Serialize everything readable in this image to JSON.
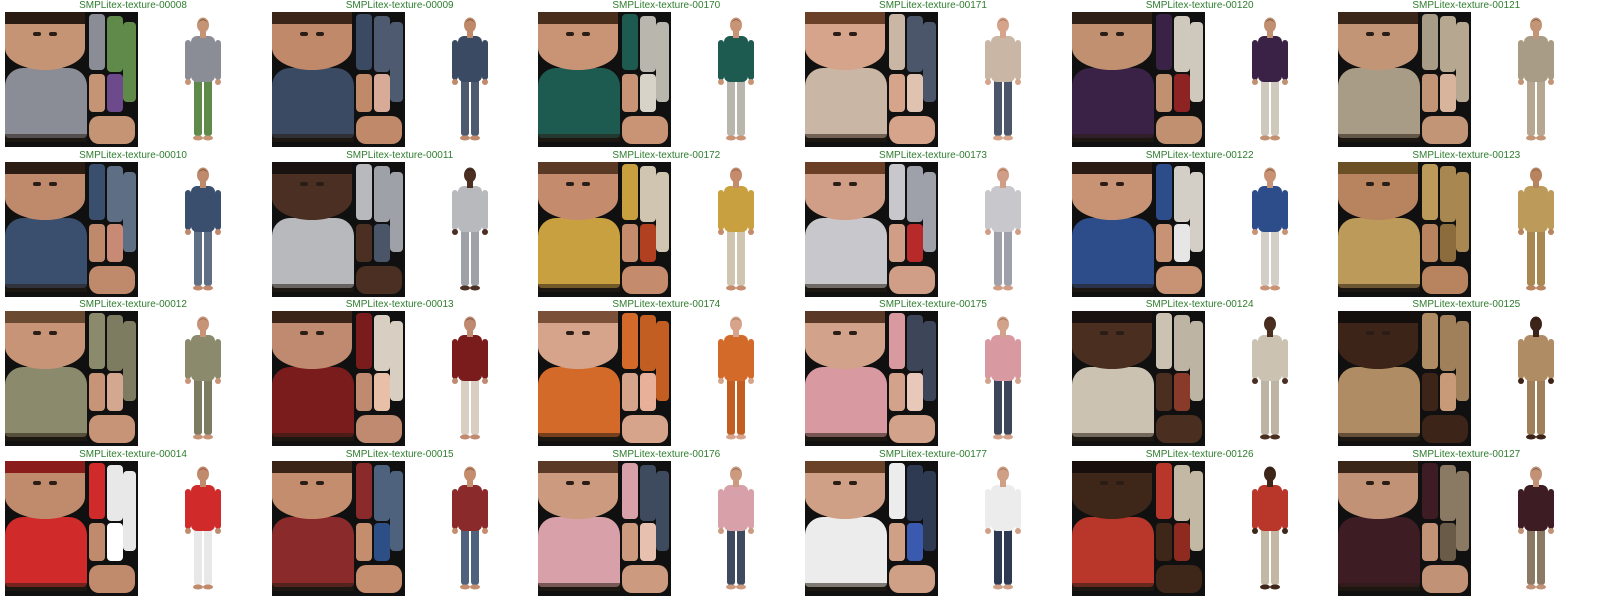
{
  "tiles": [
    {
      "label": "SMPLitex-texture-00008",
      "skin": "#c59475",
      "hair": "#2a1b12",
      "shirt": "#8a8c96",
      "pants": "#5f8a4a",
      "accent": "#6d4a8c"
    },
    {
      "label": "SMPLitex-texture-00009",
      "skin": "#c08a6a",
      "hair": "#3a2518",
      "shirt": "#3b4a63",
      "pants": "#4d5a70",
      "accent": "#d8aa98"
    },
    {
      "label": "SMPLitex-texture-00170",
      "skin": "#c99476",
      "hair": "#4a2e1c",
      "shirt": "#1d5a4f",
      "pants": "#b9b6ad",
      "accent": "#d7d3c8"
    },
    {
      "label": "SMPLitex-texture-00171",
      "skin": "#d5a48a",
      "hair": "#6a4028",
      "shirt": "#c9b6a4",
      "pants": "#4b566b",
      "accent": "#e0c2b0"
    },
    {
      "label": "SMPLitex-texture-00120",
      "skin": "#c09070",
      "hair": "#2d1e16",
      "shirt": "#3a2246",
      "pants": "#cfc8bd",
      "accent": "#8e2323"
    },
    {
      "label": "SMPLitex-texture-00121",
      "skin": "#c29577",
      "hair": "#3a271a",
      "shirt": "#a99c86",
      "pants": "#b6a890",
      "accent": "#d9b49c"
    },
    {
      "label": "SMPLitex-texture-00010",
      "skin": "#bf8a6c",
      "hair": "#2b1c14",
      "shirt": "#3a4e6e",
      "pants": "#5e6e85",
      "accent": "#c88a74"
    },
    {
      "label": "SMPLitex-texture-00011",
      "skin": "#4a2f22",
      "hair": "#1a1210",
      "shirt": "#b7b9bd",
      "pants": "#9ea1a8",
      "accent": "#4a5668"
    },
    {
      "label": "SMPLitex-texture-00172",
      "skin": "#c48c6c",
      "hair": "#5a3a24",
      "shirt": "#c8a040",
      "pants": "#d0c5b0",
      "accent": "#b04020"
    },
    {
      "label": "SMPLitex-texture-00173",
      "skin": "#d09e86",
      "hair": "#6b3f26",
      "shirt": "#c8c8cc",
      "pants": "#9ea0aa",
      "accent": "#b82a2a"
    },
    {
      "label": "SMPLitex-texture-00122",
      "skin": "#c89274",
      "hair": "#2a1c14",
      "shirt": "#2d4c8a",
      "pants": "#d4cfc6",
      "accent": "#e6e6e6"
    },
    {
      "label": "SMPLitex-texture-00123",
      "skin": "#b88460",
      "hair": "#6a5024",
      "shirt": "#bc9a5a",
      "pants": "#a88850",
      "accent": "#8c6c3c"
    },
    {
      "label": "SMPLitex-texture-00012",
      "skin": "#c89478",
      "hair": "#6a4a30",
      "shirt": "#8c8a6c",
      "pants": "#7e7c60",
      "accent": "#d4a890"
    },
    {
      "label": "SMPLitex-texture-00013",
      "skin": "#bf8a70",
      "hair": "#3a2418",
      "shirt": "#7a1c1c",
      "pants": "#d8cfc2",
      "accent": "#e8c0a8"
    },
    {
      "label": "SMPLitex-texture-00174",
      "skin": "#d6a48a",
      "hair": "#7a5038",
      "shirt": "#d46a2a",
      "pants": "#c25e22",
      "accent": "#e8b098"
    },
    {
      "label": "SMPLitex-texture-00175",
      "skin": "#d2a28a",
      "hair": "#5a3a26",
      "shirt": "#d89aa0",
      "pants": "#3c4658",
      "accent": "#e8c8b8"
    },
    {
      "label": "SMPLitex-texture-00124",
      "skin": "#4a2e20",
      "hair": "#1a1210",
      "shirt": "#cbc2b2",
      "pants": "#bdb4a4",
      "accent": "#8a3a28"
    },
    {
      "label": "SMPLitex-texture-00125",
      "skin": "#3c2418",
      "hair": "#140e0c",
      "shirt": "#b08c64",
      "pants": "#a0805a",
      "accent": "#c89a78"
    },
    {
      "label": "SMPLitex-texture-00014",
      "skin": "#c08a6c",
      "hair": "#8a1c1c",
      "shirt": "#d02a2a",
      "pants": "#e8e8e8",
      "accent": "#ffffff"
    },
    {
      "label": "SMPLitex-texture-00015",
      "skin": "#c48e6e",
      "hair": "#3a2418",
      "shirt": "#8a2a2a",
      "pants": "#4e627e",
      "accent": "#2e4e86"
    },
    {
      "label": "SMPLitex-texture-00176",
      "skin": "#cc9a7e",
      "hair": "#5a3a26",
      "shirt": "#d8a0a8",
      "pants": "#3e4a5e",
      "accent": "#e8c0b0"
    },
    {
      "label": "SMPLitex-texture-00177",
      "skin": "#d0a086",
      "hair": "#6a4228",
      "shirt": "#ececec",
      "pants": "#2e3a52",
      "accent": "#3a5ab0"
    },
    {
      "label": "SMPLitex-texture-00126",
      "skin": "#3e2618",
      "hair": "#180f0c",
      "shirt": "#b8362a",
      "pants": "#c2b8a4",
      "accent": "#8e2a20"
    },
    {
      "label": "SMPLitex-texture-00127",
      "skin": "#c29276",
      "hair": "#3a2618",
      "shirt": "#3e1c24",
      "pants": "#8a7a64",
      "accent": "#6a5a48"
    }
  ]
}
